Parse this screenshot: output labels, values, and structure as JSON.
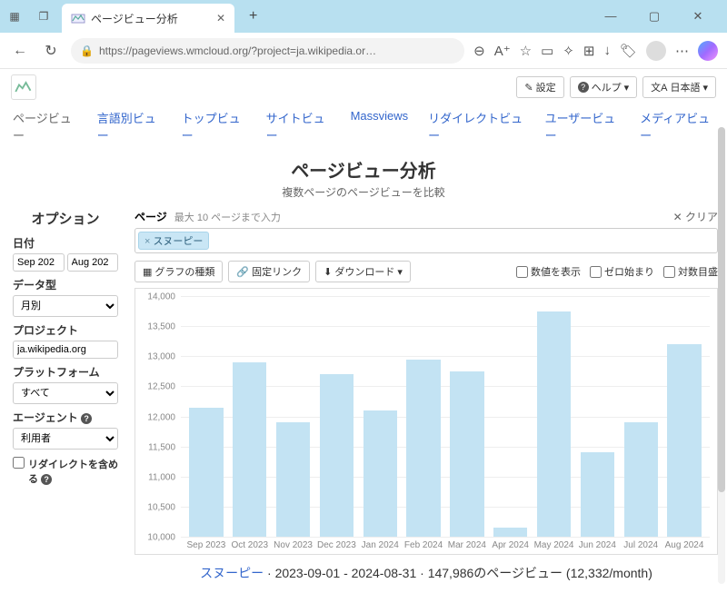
{
  "browser": {
    "tab_title": "ページビュー分析",
    "url": "https://pageviews.wmcloud.org/?project=ja.wikipedia.or…"
  },
  "header": {
    "settings": "設定",
    "help": "ヘルプ",
    "lang": "日本語"
  },
  "nav": {
    "pageviews": "ページビュー",
    "langviews": "言語別ビュー",
    "topviews": "トップビュー",
    "siteviews": "サイトビュー",
    "massviews": "Massviews",
    "redirectviews": "リダイレクトビュー",
    "userviews": "ユーザービュー",
    "mediaviews": "メディアビュー"
  },
  "title": {
    "main": "ページビュー分析",
    "sub": "複数ページのページビューを比較"
  },
  "sidebar": {
    "options": "オプション",
    "date_label": "日付",
    "date_from": "Sep 202",
    "date_to": "Aug 202",
    "datatype_label": "データ型",
    "datatype_value": "月別",
    "project_label": "プロジェクト",
    "project_value": "ja.wikipedia.org",
    "platform_label": "プラットフォーム",
    "platform_value": "すべて",
    "agent_label": "エージェント",
    "agent_value": "利用者",
    "redirects_label": "リダイレクトを含める"
  },
  "pages": {
    "label": "ページ",
    "hint": "最大 10 ページまで入力",
    "clear": "クリア",
    "token": "スヌーピー"
  },
  "controls": {
    "chart_type": "グラフの種類",
    "permalink": "固定リンク",
    "download": "ダウンロード",
    "show_values": "数値を表示",
    "begin_zero": "ゼロ始まり",
    "log_scale": "対数目盛"
  },
  "chart_data": {
    "type": "bar",
    "categories": [
      "Sep 2023",
      "Oct 2023",
      "Nov 2023",
      "Dec 2023",
      "Jan 2024",
      "Feb 2024",
      "Mar 2024",
      "Apr 2024",
      "May 2024",
      "Jun 2024",
      "Jul 2024",
      "Aug 2024"
    ],
    "values": [
      12150,
      12900,
      11900,
      12700,
      12100,
      12950,
      12750,
      10150,
      13750,
      11400,
      11900,
      13200
    ],
    "ylim": [
      10000,
      14000
    ],
    "yticks": [
      10000,
      10500,
      11000,
      11500,
      12000,
      12500,
      13000,
      13500,
      14000
    ],
    "ytick_labels": [
      "10,000",
      "10,500",
      "11,000",
      "11,500",
      "12,000",
      "12,500",
      "13,000",
      "13,500",
      "14,000"
    ]
  },
  "summary": {
    "link": "スヌーピー",
    "range": "2023-09-01 - 2024-08-31",
    "total": "147,986のページビュー",
    "monthly": "(12,332/month)"
  }
}
